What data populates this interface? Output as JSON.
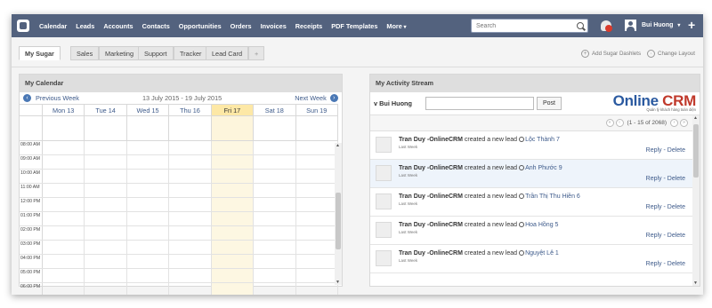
{
  "nav": {
    "items": [
      "Calendar",
      "Leads",
      "Accounts",
      "Contacts",
      "Opportunities",
      "Orders",
      "Invoices",
      "Receipts",
      "PDF Templates",
      "More"
    ],
    "search_placeholder": "Search",
    "user_name": "Bui Huong",
    "plus": "+"
  },
  "tabs": [
    "My Sugar",
    "Sales",
    "Marketing",
    "Support",
    "Tracker",
    "Lead Card",
    "+"
  ],
  "dashlet_links": {
    "add": "Add Sugar Dashlets",
    "layout": "Change Layout"
  },
  "calendar": {
    "title": "My Calendar",
    "prev": "Previous Week",
    "range": "13 July 2015 - 19 July 2015",
    "next": "Next Week",
    "days": [
      "Mon 13",
      "Tue 14",
      "Wed 15",
      "Thu 16",
      "Fri 17",
      "Sat 18",
      "Sun 19"
    ],
    "today_index": 4,
    "times": [
      "08:00 AM",
      "09:00 AM",
      "10:00 AM",
      "11:00 AM",
      "12:00 PM",
      "01:00 PM",
      "02:00 PM",
      "03:00 PM",
      "04:00 PM",
      "05:00 PM",
      "06:00 PM"
    ]
  },
  "activity": {
    "title": "My Activity Stream",
    "user_filter": "Bui Huong",
    "post_label": "Post",
    "brand_main": "nline",
    "brand_prefix": "O",
    "brand_suffix": "CRM",
    "brand_tagline": "Quản lý khách hàng toàn diện",
    "pager": "(1 - 15 of 2068)",
    "items": [
      {
        "actor": "Tran Duy -OnlineCRM",
        "text": "created a new lead",
        "lead": "Lộc Thành 7",
        "when": "Last Week",
        "actions": "Reply - Delete"
      },
      {
        "actor": "Tran Duy -OnlineCRM",
        "text": "created a new lead",
        "lead": "Anh Phước 9",
        "when": "Last Week",
        "actions": "Reply - Delete"
      },
      {
        "actor": "Tran Duy -OnlineCRM",
        "text": "created a new lead",
        "lead": "Trần Thị Thu Hiền 6",
        "when": "Last Week",
        "actions": "Reply - Delete"
      },
      {
        "actor": "Tran Duy -OnlineCRM",
        "text": "created a new lead",
        "lead": "Hoa Hồng 5",
        "when": "Last Week",
        "actions": "Reply - Delete"
      },
      {
        "actor": "Tran Duy -OnlineCRM",
        "text": "created a new lead",
        "lead": "Nguyệt Lê 1",
        "when": "Last Week",
        "actions": "Reply - Delete"
      }
    ]
  }
}
